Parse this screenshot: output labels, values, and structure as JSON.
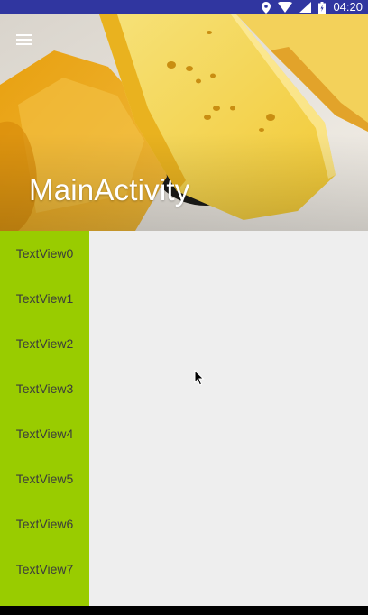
{
  "status_bar": {
    "time": "04:20",
    "icons": [
      "location-icon",
      "wifi-icon",
      "signal-icon",
      "battery-icon"
    ]
  },
  "app_bar": {
    "title": "MainActivity",
    "menu_icon": "hamburger-menu-icon"
  },
  "side_list": {
    "items": [
      {
        "label": "TextView0"
      },
      {
        "label": "TextView1"
      },
      {
        "label": "TextView2"
      },
      {
        "label": "TextView3"
      },
      {
        "label": "TextView4"
      },
      {
        "label": "TextView5"
      },
      {
        "label": "TextView6"
      },
      {
        "label": "TextView7"
      }
    ]
  },
  "colors": {
    "status_bar": "#3036a0",
    "list_background": "#99cc00",
    "content_background": "#eeeeee",
    "title_text": "#ffffff"
  }
}
